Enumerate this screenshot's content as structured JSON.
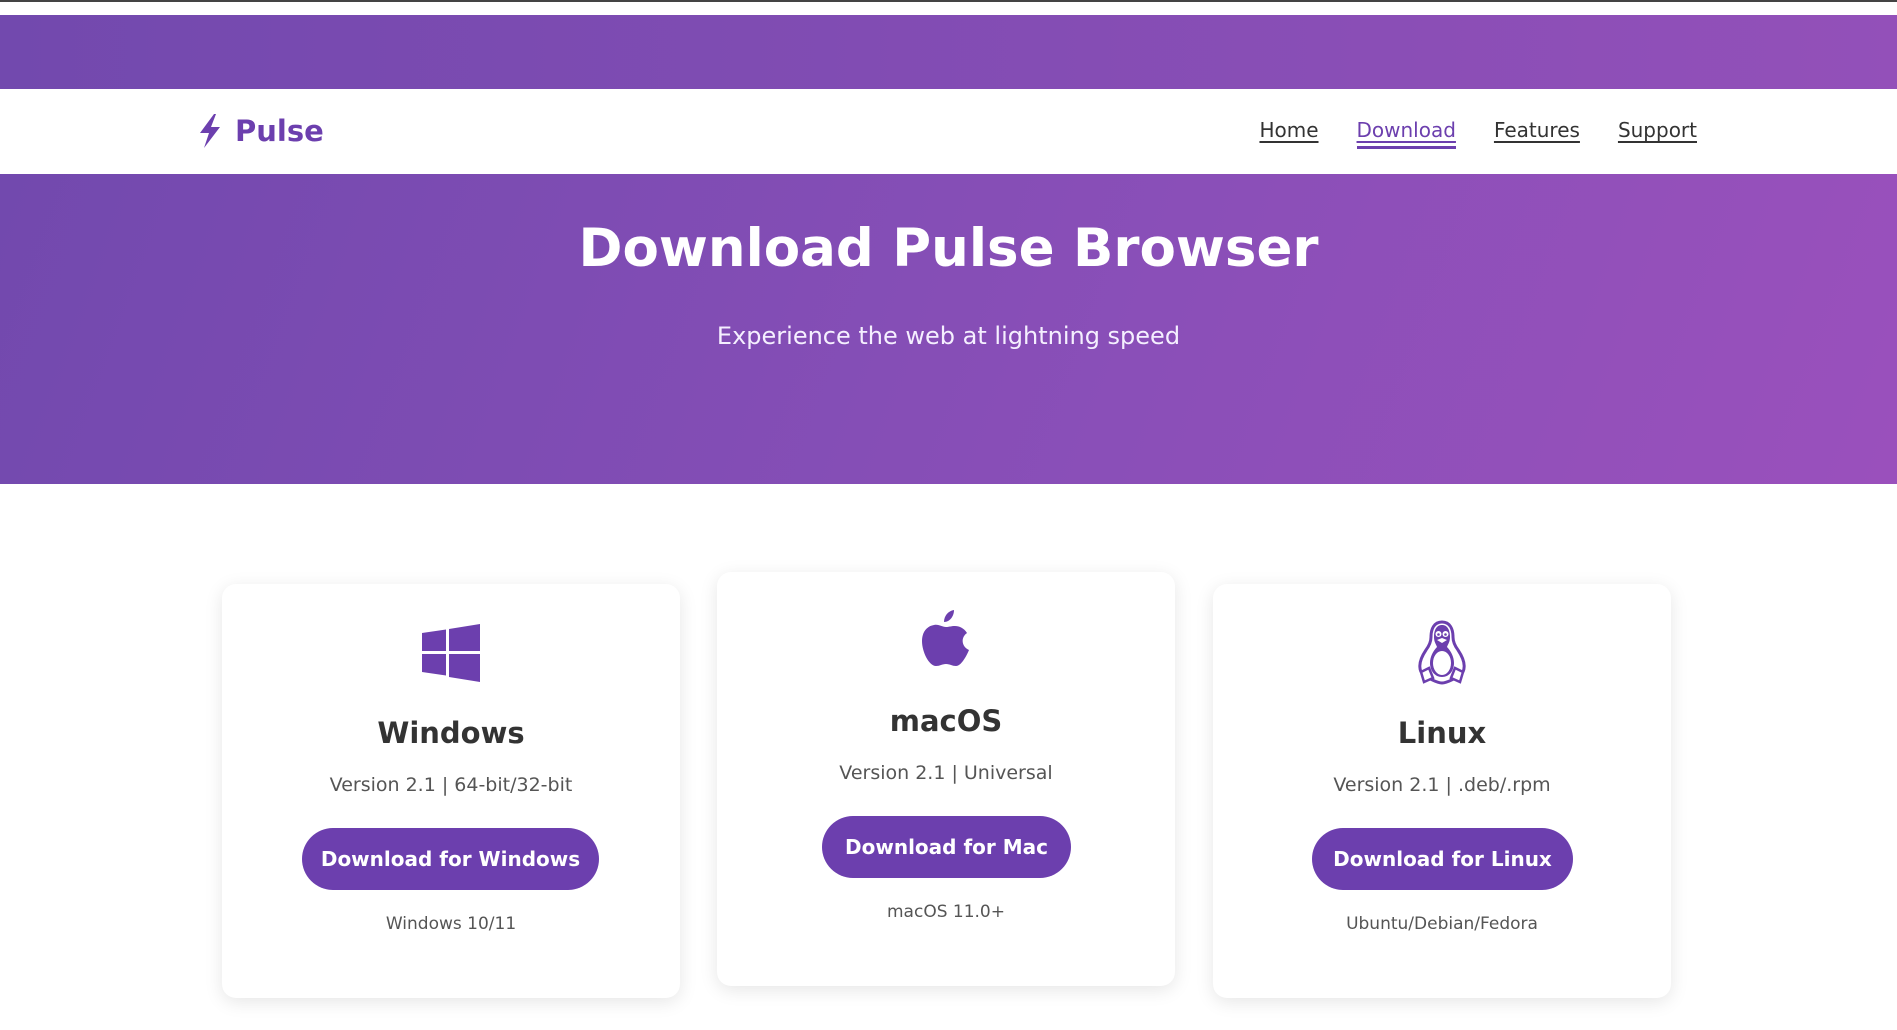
{
  "brand": {
    "name": "Pulse",
    "icon": "lightning-bolt-icon",
    "color": "#6c3fae"
  },
  "nav": {
    "links": [
      {
        "label": "Home",
        "active": false
      },
      {
        "label": "Download",
        "active": true
      },
      {
        "label": "Features",
        "active": false
      },
      {
        "label": "Support",
        "active": false
      }
    ]
  },
  "hero": {
    "title": "Download Pulse Browser",
    "subtitle": "Experience the web at lightning speed",
    "gradient_start": "#7249ae",
    "gradient_end": "#9a50bc"
  },
  "downloads": [
    {
      "os": "Windows",
      "icon": "windows-icon",
      "version": "Version 2.1 | 64-bit/32-bit",
      "button": "Download for Windows",
      "requirements": "Windows 10/11"
    },
    {
      "os": "macOS",
      "icon": "apple-icon",
      "version": "Version 2.1 | Universal",
      "button": "Download for Mac",
      "requirements": "macOS 11.0+"
    },
    {
      "os": "Linux",
      "icon": "linux-penguin-icon",
      "version": "Version 2.1 | .deb/.rpm",
      "button": "Download for Linux",
      "requirements": "Ubuntu/Debian/Fedora"
    }
  ],
  "colors": {
    "accent": "#6c3fae",
    "text": "#333333",
    "muted": "#555555"
  }
}
